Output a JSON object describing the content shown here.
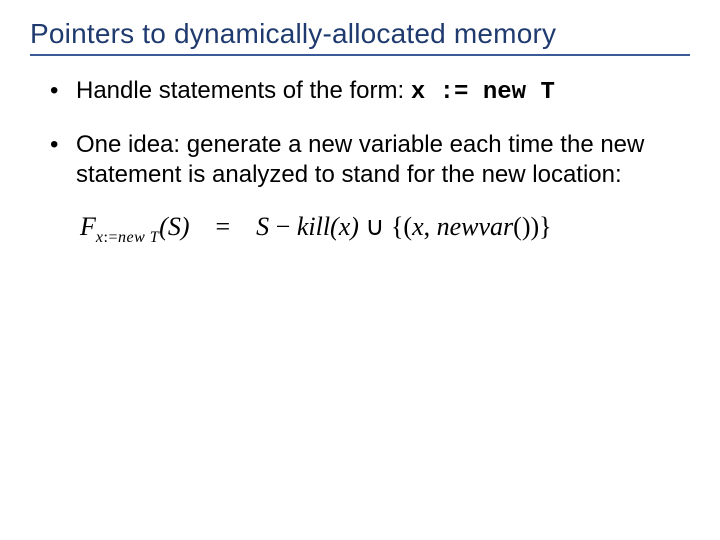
{
  "title": "Pointers to dynamically-allocated memory",
  "bullets": {
    "b1": {
      "prefix": "Handle statements of the form: ",
      "code": "x := new T"
    },
    "b2": {
      "text": "One idea: generate a new variable each time the new statement is analyzed to stand for the new location:"
    }
  },
  "formula": {
    "F": "F",
    "sub_x": "x",
    "sub_assign": ":=",
    "sub_new": "new ",
    "sub_T": "T",
    "lparen_S_rparen": "(S)",
    "eq": "=",
    "rhs_S": "S",
    "minus": " − ",
    "kill": "kill",
    "kill_arg": "(x)",
    "cup": " ∪ ",
    "set_open": "{(",
    "x": "x",
    "comma": ", ",
    "newvar": "newvar",
    "newvar_call": "()",
    "set_close": ")}"
  }
}
